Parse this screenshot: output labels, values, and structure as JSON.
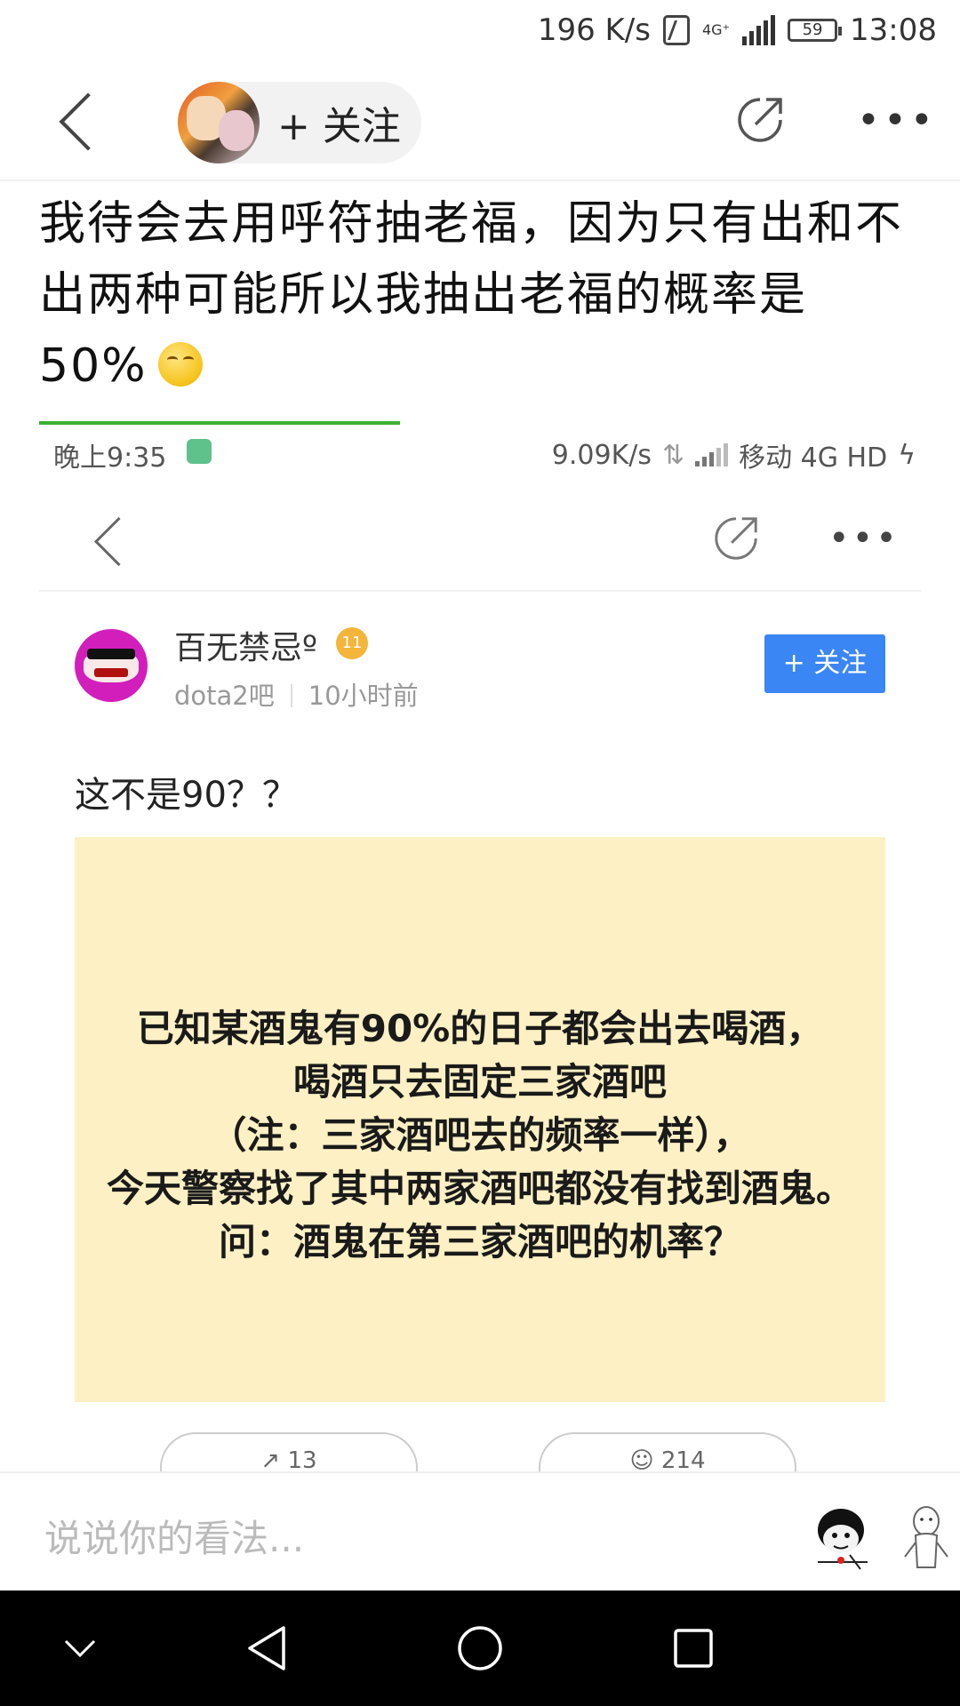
{
  "status_bar": {
    "net_speed": "196 K/s",
    "network": "4G⁺",
    "battery": "59",
    "time": "13:08"
  },
  "top_nav": {
    "follow_label": "+ 关注"
  },
  "post": {
    "title": "我待会去用呼符抽老福，因为只有出和不出两种可能所以我抽出老福的概率是50%"
  },
  "screenshot": {
    "status": {
      "time": "晚上9:35",
      "speed": "9.09K/s",
      "carrier": "移动 4G HD"
    },
    "poster": {
      "name": "百无禁忌º",
      "level": "11",
      "forum": "dota2吧",
      "time_ago": "10小时前",
      "follow_label": "+ 关注"
    },
    "post_text": "这不是90？？",
    "image_text": [
      "已知某酒鬼有90%的日子都会出去喝酒，",
      "喝酒只去固定三家酒吧",
      "（注：三家酒吧去的频率一样），",
      "今天警察找了其中两家酒吧都没有找到酒鬼。",
      "问：酒鬼在第三家酒吧的机率？"
    ],
    "share_count": "13",
    "reply_count": "214"
  },
  "comment_bar": {
    "placeholder": "说说你的看法..."
  },
  "colors": {
    "progress": "#3cb034",
    "follow_button": "#3a86f4",
    "image_bg": "#fcf0c4"
  }
}
